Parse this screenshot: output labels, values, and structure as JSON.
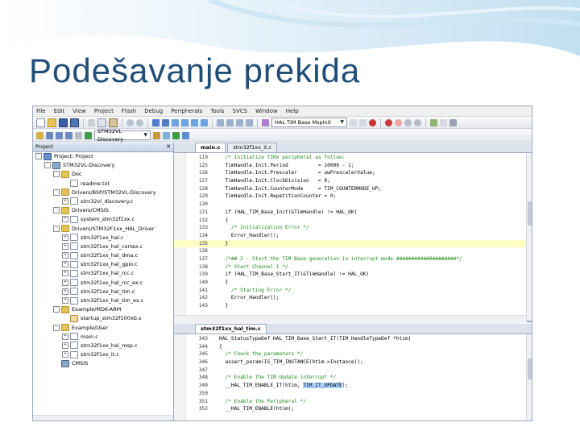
{
  "slide": {
    "title": "Podešavanje prekida"
  },
  "menu": [
    "File",
    "Edit",
    "View",
    "Project",
    "Flash",
    "Debug",
    "Peripherals",
    "Tools",
    "SVCS",
    "Window",
    "Help"
  ],
  "toolbar": {
    "target_combo": "HAL TIM Base MspInit",
    "target_select": "STM32VL Discovery"
  },
  "project_pane": {
    "title": "Project",
    "items": [
      {
        "label": "Project: Project",
        "depth": 0,
        "icon": "proj",
        "exp": "-"
      },
      {
        "label": "STM32VL-Discovery",
        "depth": 1,
        "icon": "gear",
        "exp": "-"
      },
      {
        "label": "Doc",
        "depth": 2,
        "icon": "folder",
        "exp": "-"
      },
      {
        "label": "readme.txt",
        "depth": 3,
        "icon": "file",
        "exp": ""
      },
      {
        "label": "Drivers/BSP/STM32VL-Discovery",
        "depth": 2,
        "icon": "folder",
        "exp": "-"
      },
      {
        "label": "stm32vl_discovery.c",
        "depth": 3,
        "icon": "file",
        "exp": "+"
      },
      {
        "label": "Drivers/CMSIS",
        "depth": 2,
        "icon": "folder",
        "exp": "-"
      },
      {
        "label": "system_stm32f1xx.c",
        "depth": 3,
        "icon": "file",
        "exp": "+"
      },
      {
        "label": "Drivers/STM32F1xx_HAL_Driver",
        "depth": 2,
        "icon": "folder",
        "exp": "-"
      },
      {
        "label": "stm32f1xx_hal.c",
        "depth": 3,
        "icon": "file",
        "exp": "+"
      },
      {
        "label": "stm32f1xx_hal_cortex.c",
        "depth": 3,
        "icon": "file",
        "exp": "+"
      },
      {
        "label": "stm32f1xx_hal_dma.c",
        "depth": 3,
        "icon": "file",
        "exp": "+"
      },
      {
        "label": "stm32f1xx_hal_gpio.c",
        "depth": 3,
        "icon": "file",
        "exp": "+"
      },
      {
        "label": "stm32f1xx_hal_rcc.c",
        "depth": 3,
        "icon": "file",
        "exp": "+"
      },
      {
        "label": "stm32f1xx_hal_rcc_ex.c",
        "depth": 3,
        "icon": "file",
        "exp": "+"
      },
      {
        "label": "stm32f1xx_hal_tim.c",
        "depth": 3,
        "icon": "file",
        "exp": "+"
      },
      {
        "label": "stm32f1xx_hal_tim_ex.c",
        "depth": 3,
        "icon": "file",
        "exp": "+"
      },
      {
        "label": "Example/MDK-ARM",
        "depth": 2,
        "icon": "folder",
        "exp": "-"
      },
      {
        "label": "startup_stm32f100xb.s",
        "depth": 3,
        "icon": "asm",
        "exp": ""
      },
      {
        "label": "Example/User",
        "depth": 2,
        "icon": "folder",
        "exp": "-"
      },
      {
        "label": "main.c",
        "depth": 3,
        "icon": "file",
        "exp": "+"
      },
      {
        "label": "stm32f1xx_hal_msp.c",
        "depth": 3,
        "icon": "file",
        "exp": "+"
      },
      {
        "label": "stm32f1xx_it.c",
        "depth": 3,
        "icon": "file",
        "exp": "+"
      },
      {
        "label": "CMSIS",
        "depth": 2,
        "icon": "gear",
        "exp": ""
      }
    ]
  },
  "editor_top": {
    "tabs": [
      {
        "label": "main.c",
        "active": true
      },
      {
        "label": "stm32f1xx_it.c",
        "active": false
      }
    ],
    "lines": [
      {
        "n": "119",
        "code": "  /* Initialize TIMx peripheral as follow:",
        "type": "cmt"
      },
      {
        "n": "125",
        "code": "  TimHandle.Init.Period          = 10000 - 1;",
        "type": "code"
      },
      {
        "n": "126",
        "code": "  TimHandle.Init.Prescaler       = uwPrescalerValue;",
        "type": "code"
      },
      {
        "n": "127",
        "code": "  TimHandle.Init.ClockDivision   = 0;",
        "type": "code"
      },
      {
        "n": "128",
        "code": "  TimHandle.Init.CounterMode     = TIM_COUNTERMODE_UP;",
        "type": "code"
      },
      {
        "n": "129",
        "code": "  TimHandle.Init.RepetitionCounter = 0;",
        "type": "code"
      },
      {
        "n": "130",
        "code": "",
        "type": "code"
      },
      {
        "n": "131",
        "code": "  if (HAL_TIM_Base_Init(&TimHandle) != HAL_OK)",
        "type": "code"
      },
      {
        "n": "132",
        "code": "  {",
        "type": "code"
      },
      {
        "n": "133",
        "code": "    /* Initialization Error */",
        "type": "cmt"
      },
      {
        "n": "134",
        "code": "    Error_Handler();",
        "type": "code"
      },
      {
        "n": "135",
        "code": "  }",
        "type": "code",
        "hl": true
      },
      {
        "n": "136",
        "code": "",
        "type": "code"
      },
      {
        "n": "137",
        "code": "  /*## 2 - Start the TIM Base generation in interrupt mode ####################*/",
        "type": "cmt"
      },
      {
        "n": "138",
        "code": "  /* Start Channel 1 */",
        "type": "cmt"
      },
      {
        "n": "139",
        "code": "  if (HAL_TIM_Base_Start_IT(&TimHandle) != HAL_OK)",
        "type": "code"
      },
      {
        "n": "140",
        "code": "  {",
        "type": "code"
      },
      {
        "n": "141",
        "code": "    /* Starting Error */",
        "type": "cmt"
      },
      {
        "n": "142",
        "code": "    Error_Handler();",
        "type": "code"
      },
      {
        "n": "143",
        "code": "  }",
        "type": "code"
      }
    ]
  },
  "editor_bottom": {
    "tabs": [
      {
        "label": "stm32f1xx_hal_tim.c",
        "active": true
      }
    ],
    "lines": [
      {
        "n": "343",
        "code": "HAL_StatusTypeDef HAL_TIM_Base_Start_IT(TIM_HandleTypeDef *htim)",
        "type": "code"
      },
      {
        "n": "344",
        "code": "{",
        "type": "code"
      },
      {
        "n": "345",
        "code": "  /* Check the parameters */",
        "type": "cmt"
      },
      {
        "n": "346",
        "code": "  assert_param(IS_TIM_INSTANCE(htim->Instance));",
        "type": "code"
      },
      {
        "n": "347",
        "code": "",
        "type": "code"
      },
      {
        "n": "348",
        "code": "  /* Enable the TIM Update interrupt */",
        "type": "cmt"
      },
      {
        "n": "349",
        "code": "  __HAL_TIM_ENABLE_IT(htim, TIM_IT_UPDATE);",
        "type": "sel"
      },
      {
        "n": "350",
        "code": "",
        "type": "code"
      },
      {
        "n": "351",
        "code": "  /* Enable the Peripheral */",
        "type": "cmt"
      },
      {
        "n": "352",
        "code": "  __HAL_TIM_ENABLE(htim);",
        "type": "code"
      }
    ]
  },
  "colors": {
    "title": "#1f4e79",
    "comment": "#1a8c1a",
    "selection": "#a8d2ff",
    "current_line": "#ffffc8"
  }
}
